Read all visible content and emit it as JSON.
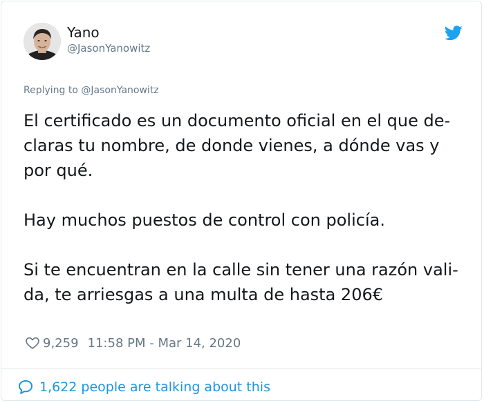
{
  "author": {
    "name": "Yano",
    "handle": "@JasonYanowitz"
  },
  "reply": {
    "prefix": "Replying to ",
    "to": "@JasonYanowitz"
  },
  "tweet": {
    "lines": [
      "El certificado es un documento oficial en el que de-",
      "claras tu nombre, de donde vienes, a dónde vas y",
      "por qué.",
      "",
      "Hay muchos puestos de control con policía.",
      "",
      "Si te encuentran en la calle sin tener una razón vali-",
      "da, te arriesgas a una multa de hasta 206€"
    ]
  },
  "meta": {
    "likes": "9,259",
    "timestamp": "11:58 PM - Mar 14, 2020"
  },
  "footer": {
    "talking": "1,622 people are talking about this"
  },
  "colors": {
    "twitter_blue": "#1da1f2",
    "link_blue": "#1b95e0",
    "secondary_text": "#657786"
  },
  "icons": {
    "logo": "twitter-bird-icon",
    "like": "heart-icon",
    "conversation": "speech-bubble-icon"
  }
}
